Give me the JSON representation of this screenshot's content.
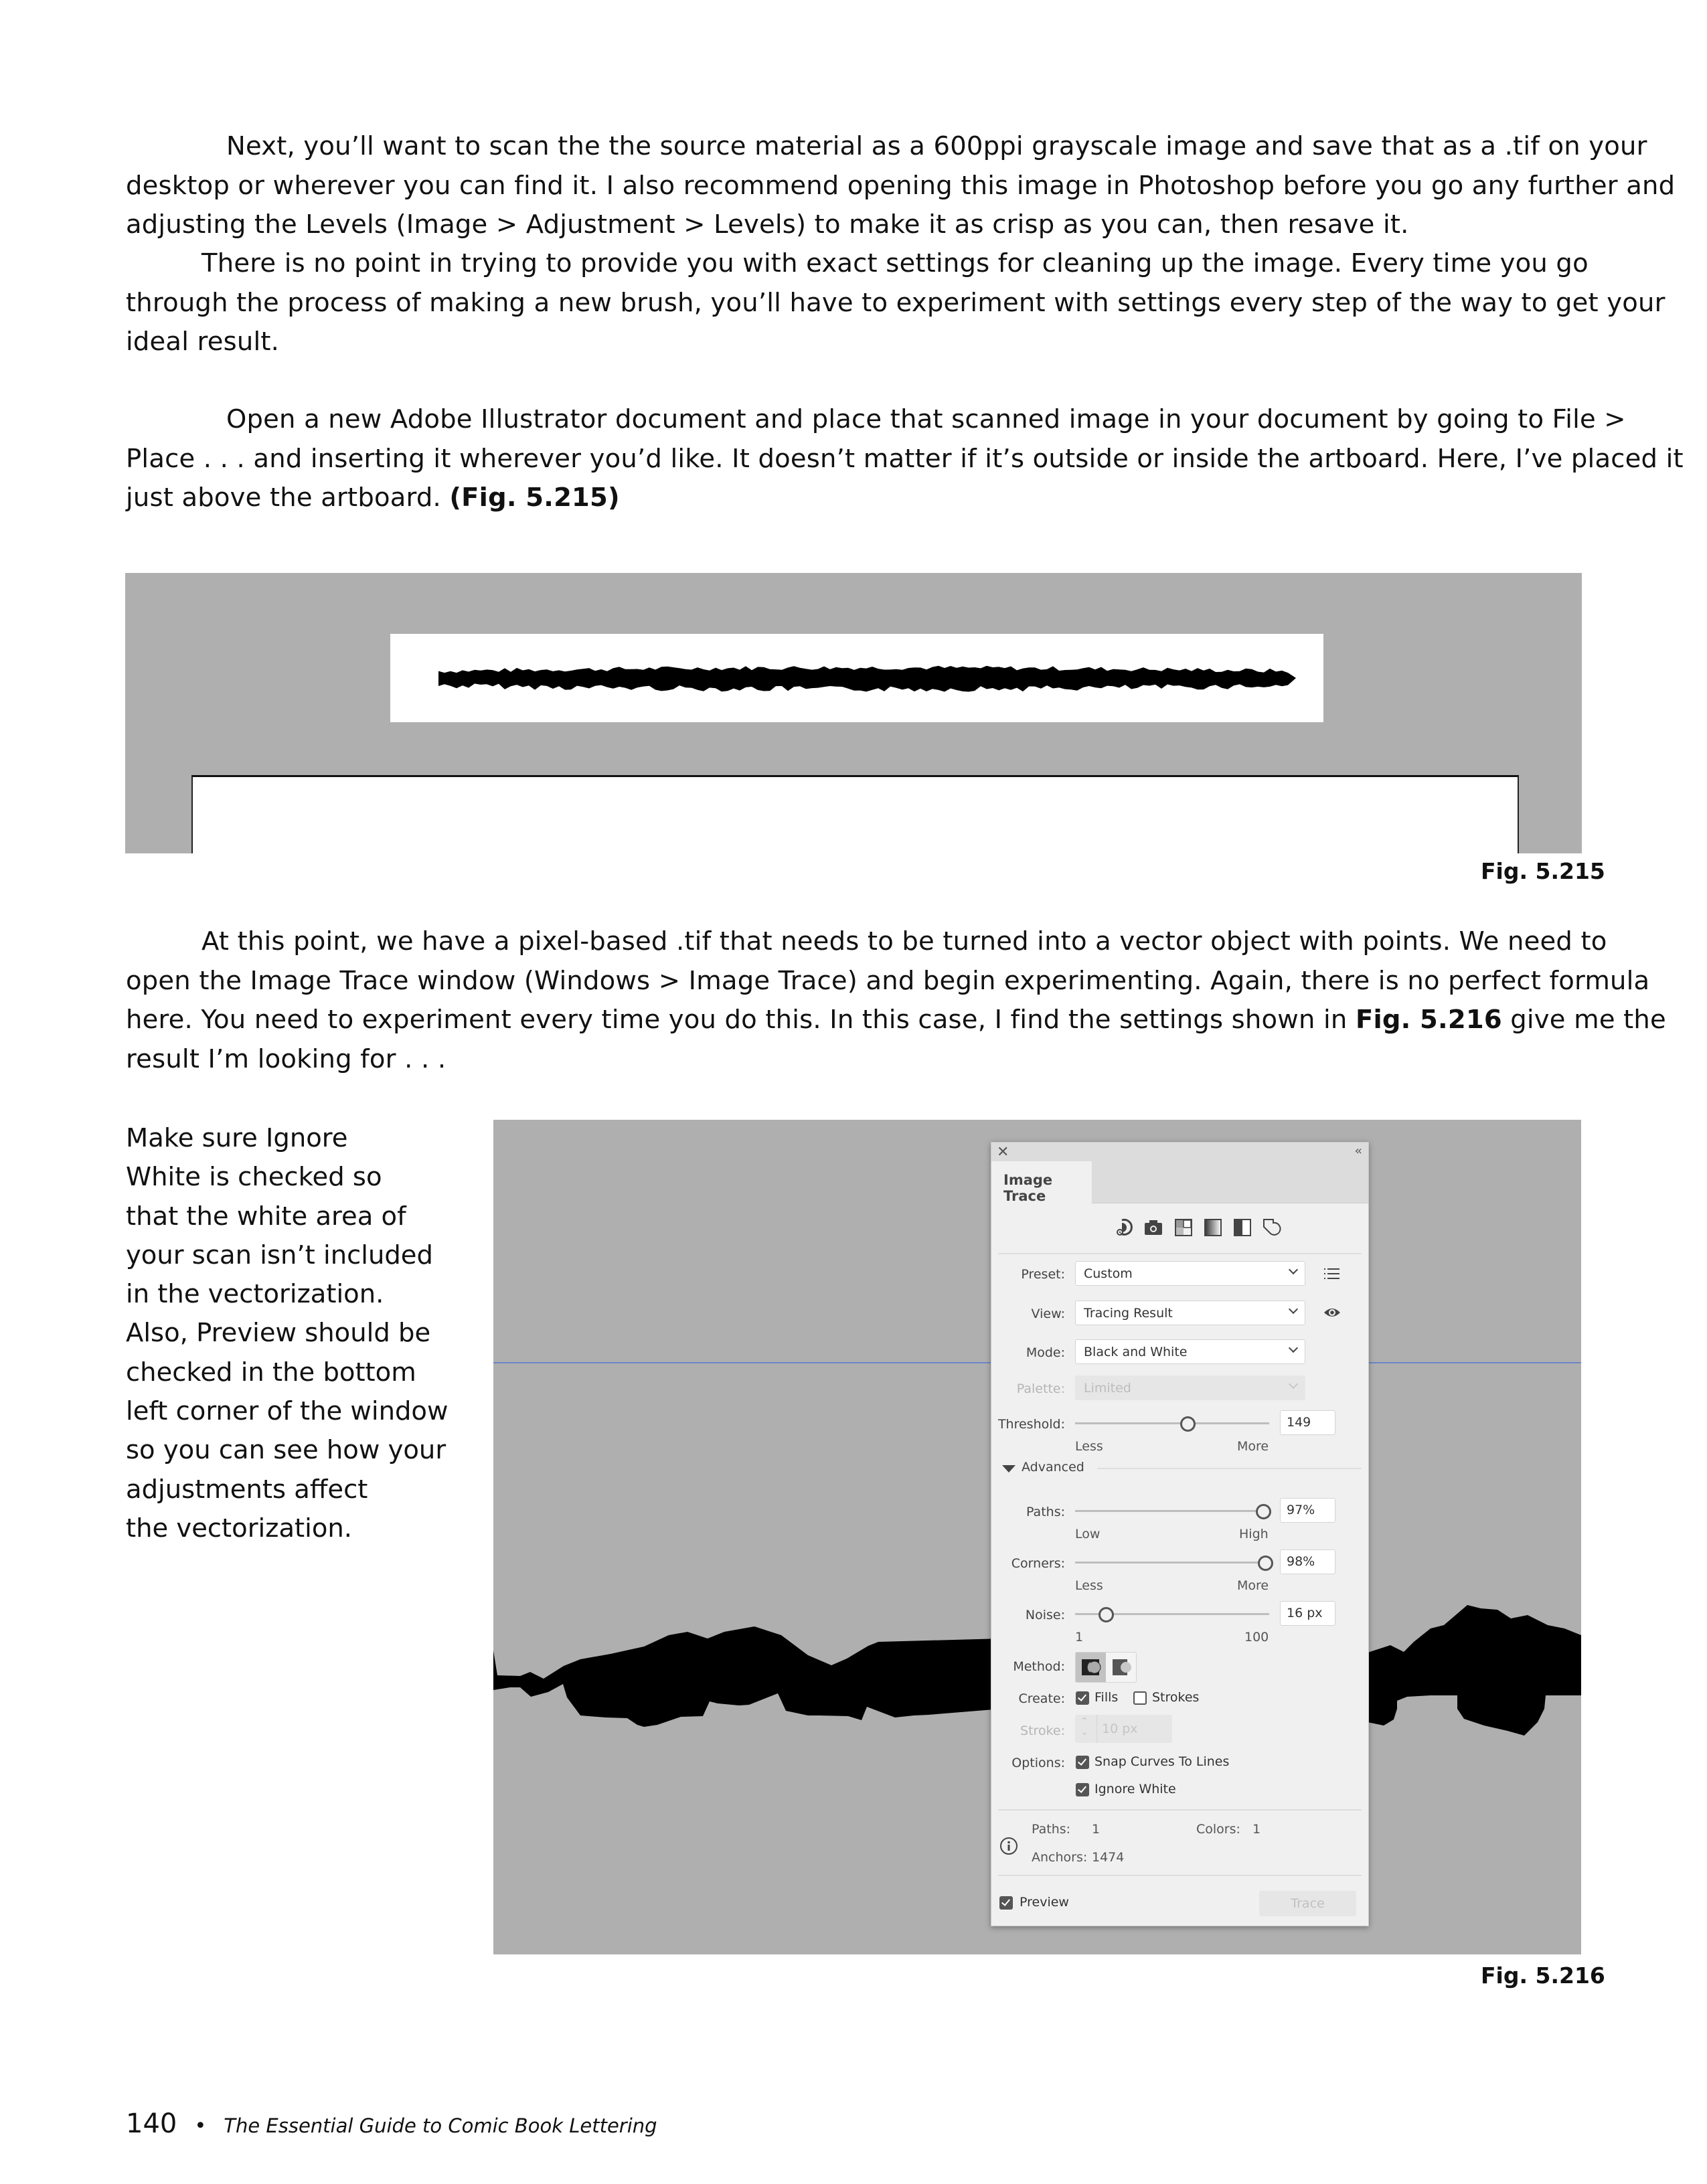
{
  "paragraphs": {
    "p1": {
      "lines": [
        "Next, you’ll want to scan the the source material as a 600ppi grayscale image and save that as a .tif on your",
        "desktop or wherever you can find it. I also recommend opening this image in Photoshop before you go any further and",
        "adjusting the Levels (Image > Adjustment > Levels) to make it as crisp as you can, then resave it."
      ]
    },
    "p2": {
      "lines": [
        "There is no point in trying to provide you with exact settings for cleaning up the image. Every time you go",
        "through the process of making a new brush, you’ll have to experiment with settings every step of the way to get your",
        "ideal result."
      ]
    },
    "p3": {
      "lines": [
        "Open a new Adobe Illustrator document and place that scanned image in your document by going to File >",
        "Place . . . and inserting it wherever you’d like. It doesn’t matter if it’s outside or inside the artboard. Here, I’ve placed it",
        "just above the artboard. "
      ],
      "ref": "(Fig. 5.215)"
    },
    "p4": {
      "lines": [
        "At this point, we have a pixel-based .tif that needs to be turned into a vector object with points. We need to",
        "open the Image Trace window (Windows > Image Trace) and begin experimenting. Again, there is no perfect formula",
        "here. You need to experiment every time you do this. In this case, I find the settings shown in ",
        "result I’m looking for . . ."
      ],
      "ref": "Fig. 5.216",
      "after_ref": " give me the"
    }
  },
  "side_note": {
    "lines": [
      "Make sure Ignore",
      "White is checked so",
      "that the white area of",
      "your scan isn’t included",
      "in the vectorization.",
      "Also, Preview should be",
      "checked in the bottom",
      "left corner of the window",
      "so you can see how your",
      "adjustments affect",
      "the vectorization."
    ]
  },
  "figures": {
    "fig215": {
      "caption": "Fig. 5.215"
    },
    "fig216": {
      "caption": "Fig. 5.216"
    }
  },
  "image_trace_panel": {
    "tab": "Image Trace",
    "close_icon": "close-icon",
    "collapse_icon": "collapse-icon",
    "collapse_glyph": "‹‹",
    "close_glyph": "✕",
    "preset_icons": [
      "auto-color-icon",
      "high-color-icon",
      "low-color-icon",
      "grayscale-icon",
      "black-and-white-icon",
      "outline-icon"
    ],
    "preset": {
      "label": "Preset:",
      "value": "Custom"
    },
    "view": {
      "label": "View:",
      "value": "Tracing Result"
    },
    "mode": {
      "label": "Mode:",
      "value": "Black and White"
    },
    "palette": {
      "label": "Palette:",
      "value": "Limited",
      "disabled": true
    },
    "threshold": {
      "label": "Threshold:",
      "value": "149",
      "min_label": "Less",
      "max_label": "More",
      "position": 0.58
    },
    "advanced": {
      "label": "Advanced",
      "expanded": true
    },
    "paths": {
      "label": "Paths:",
      "value": "97%",
      "min_label": "Low",
      "max_label": "High",
      "position": 0.97
    },
    "corners": {
      "label": "Corners:",
      "value": "98%",
      "min_label": "Less",
      "max_label": "More",
      "position": 0.98
    },
    "noise": {
      "label": "Noise:",
      "value": "16 px",
      "min_label": "1",
      "max_label": "100",
      "position": 0.16
    },
    "method": {
      "label": "Method:",
      "options": [
        "abutting",
        "overlapping"
      ],
      "selected": "abutting"
    },
    "create": {
      "label": "Create:",
      "fills": {
        "label": "Fills",
        "checked": true
      },
      "strokes": {
        "label": "Strokes",
        "checked": false
      }
    },
    "stroke": {
      "label": "Stroke:",
      "value": "10 px",
      "disabled": true
    },
    "options": {
      "label": "Options:",
      "snap_curves": {
        "label": "Snap Curves To Lines",
        "checked": true
      },
      "ignore_white": {
        "label": "Ignore White",
        "checked": true
      }
    },
    "info": {
      "paths_label": "Paths:",
      "paths_value": "1",
      "colors_label": "Colors:",
      "colors_value": "1",
      "anchors_label": "Anchors:",
      "anchors_value": "1474"
    },
    "preview": {
      "label": "Preview",
      "checked": true
    },
    "trace_button": "Trace"
  },
  "footer": {
    "page_number": "140",
    "separator": "•",
    "book_title": "The Essential Guide to Comic Book Lettering"
  }
}
